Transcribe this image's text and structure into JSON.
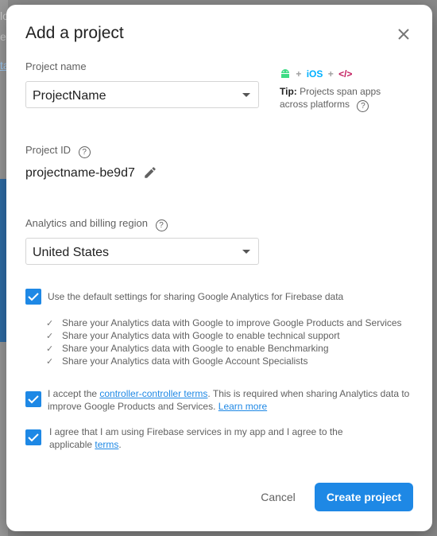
{
  "background": {
    "line1": "lo",
    "line2": "e",
    "line3": "ta"
  },
  "dialog": {
    "title": "Add a project",
    "project_name": {
      "label": "Project name",
      "value": "ProjectName"
    },
    "tip": {
      "bold": "Tip:",
      "text": "Projects span apps across platforms",
      "platforms": [
        "android-icon",
        "iOS",
        "</>"
      ]
    },
    "project_id": {
      "label": "Project ID",
      "value": "projectname-be9d7"
    },
    "region": {
      "label": "Analytics and billing region",
      "value": "United States"
    },
    "default_settings": {
      "checked": true,
      "text": "Use the default settings for sharing Google Analytics for Firebase data"
    },
    "sharing_items": [
      "Share your Analytics data with Google to improve Google Products and Services",
      "Share your Analytics data with Google to enable technical support",
      "Share your Analytics data with Google to enable Benchmarking",
      "Share your Analytics data with Google Account Specialists"
    ],
    "controller_terms": {
      "checked": true,
      "prefix": "I accept the ",
      "link": "controller-controller terms",
      "middle": ". This is required when sharing Analytics data to improve Google Products and Services.",
      "learn_more": "Learn more"
    },
    "firebase_terms": {
      "checked": true,
      "prefix": "I agree that I am using Firebase services in my app and I agree to the applicable ",
      "link": "terms",
      "suffix": "."
    },
    "buttons": {
      "cancel": "Cancel",
      "create": "Create project"
    }
  },
  "colors": {
    "accent": "#1e88e5",
    "android": "#3ddc84",
    "ios": "#00b0ff",
    "web": "#c2185b"
  }
}
